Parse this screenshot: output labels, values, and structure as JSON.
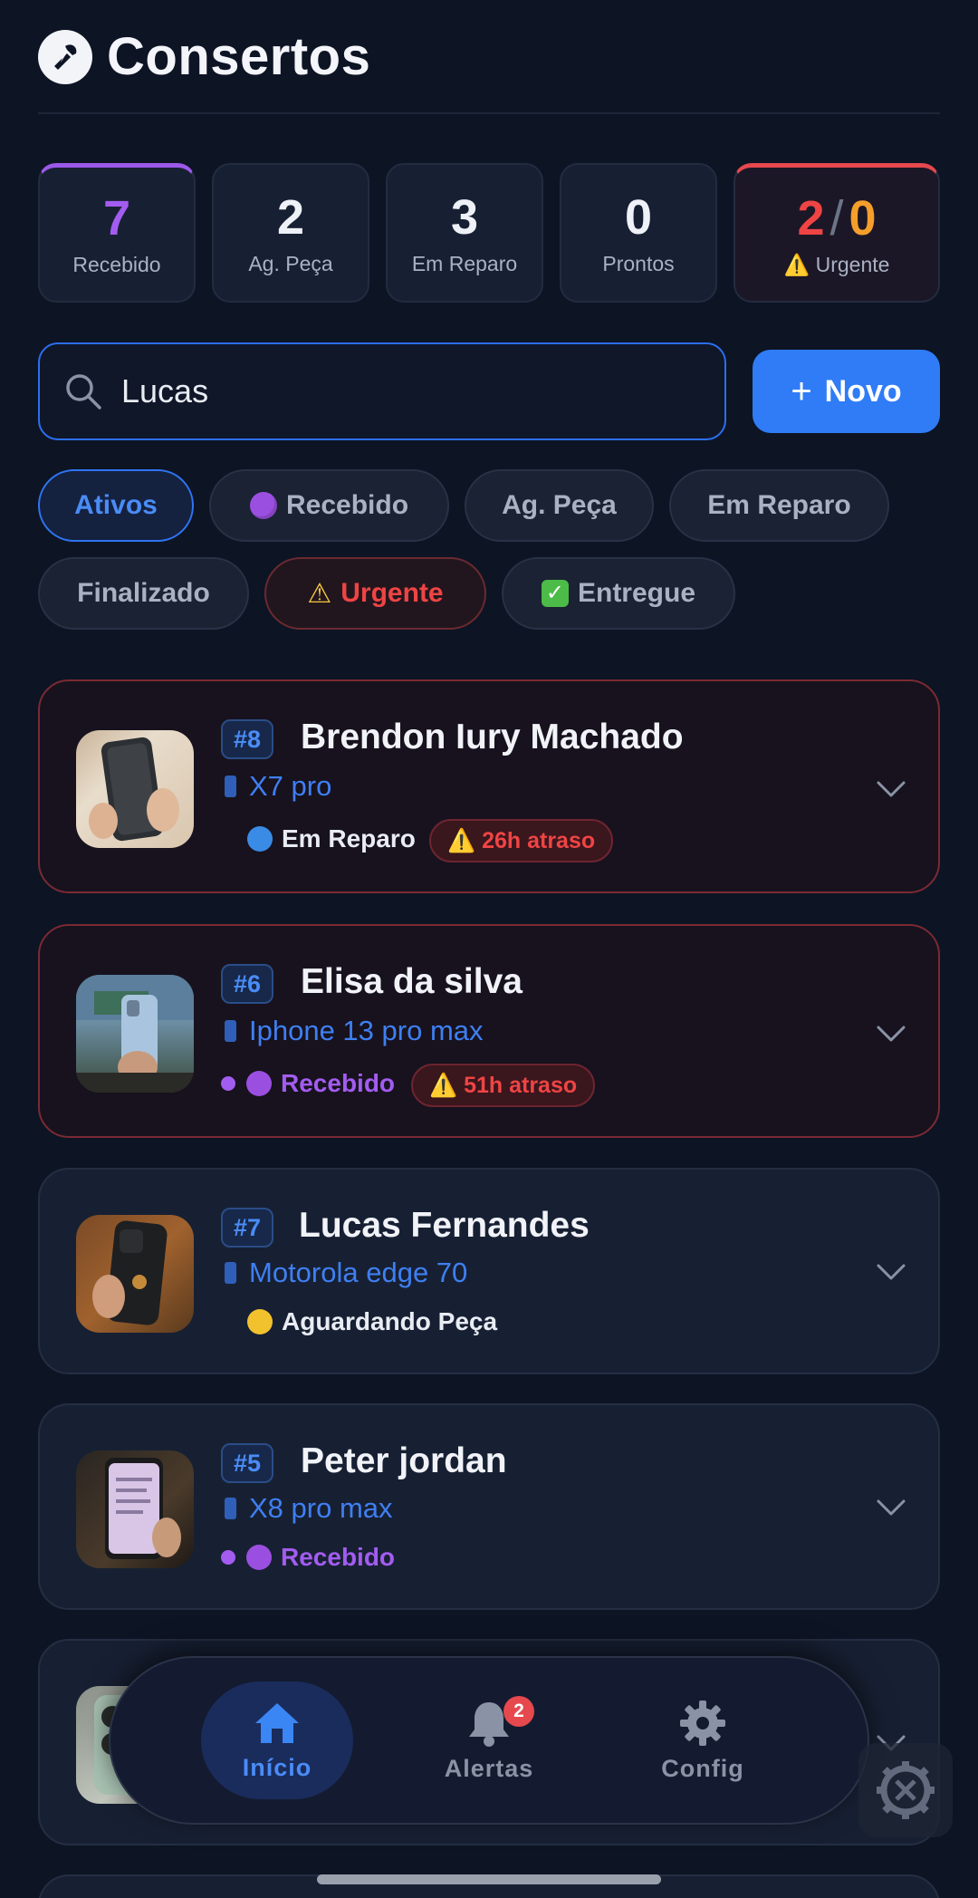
{
  "app": {
    "title": "Consertos"
  },
  "stats": {
    "recebido": {
      "value": "7",
      "label": "Recebido"
    },
    "ag_peca": {
      "value": "2",
      "label": "Ag. Peça"
    },
    "em_reparo": {
      "value": "3",
      "label": "Em Reparo"
    },
    "prontos": {
      "value": "0",
      "label": "Prontos"
    },
    "urgente": {
      "value_a": "2",
      "separator": "/",
      "value_b": "0",
      "label": "⚠️ Urgente"
    }
  },
  "search": {
    "value": "Lucas"
  },
  "new_button": {
    "icon": "+",
    "label": "Novo"
  },
  "filters": {
    "ativos": "Ativos",
    "recebido": "Recebido",
    "ag_peca": "Ag. Peça",
    "em_reparo": "Em Reparo",
    "finalizado": "Finalizado",
    "urgente": "Urgente",
    "entregue": "Entregue"
  },
  "orders": [
    {
      "id": "#8",
      "name": "Brendon Iury Machado",
      "model": "X7 pro",
      "status": "Em Reparo",
      "status_color": "#3a8be6",
      "late": "⚠️ 26h atraso"
    },
    {
      "id": "#6",
      "name": "Elisa da silva",
      "model": "Iphone 13 pro max",
      "status": "Recebido",
      "status_color": "#9b4fe0",
      "late": "⚠️ 51h atraso"
    },
    {
      "id": "#7",
      "name": "Lucas Fernandes",
      "model": "Motorola edge 70",
      "status": "Aguardando Peça",
      "status_color": "#f2c12e"
    },
    {
      "id": "#5",
      "name": "Peter jordan",
      "model": "X8 pro max",
      "status": "Recebido",
      "status_color": "#9b4fe0"
    }
  ],
  "nav": {
    "inicio": "Início",
    "alertas": "Alertas",
    "alertas_badge": "2",
    "config": "Config"
  },
  "colors": {
    "background": "#0d1424",
    "accent": "#2f7cf6",
    "purple": "#a35cf0",
    "danger": "#ef4444",
    "warning": "#f59e2b"
  }
}
